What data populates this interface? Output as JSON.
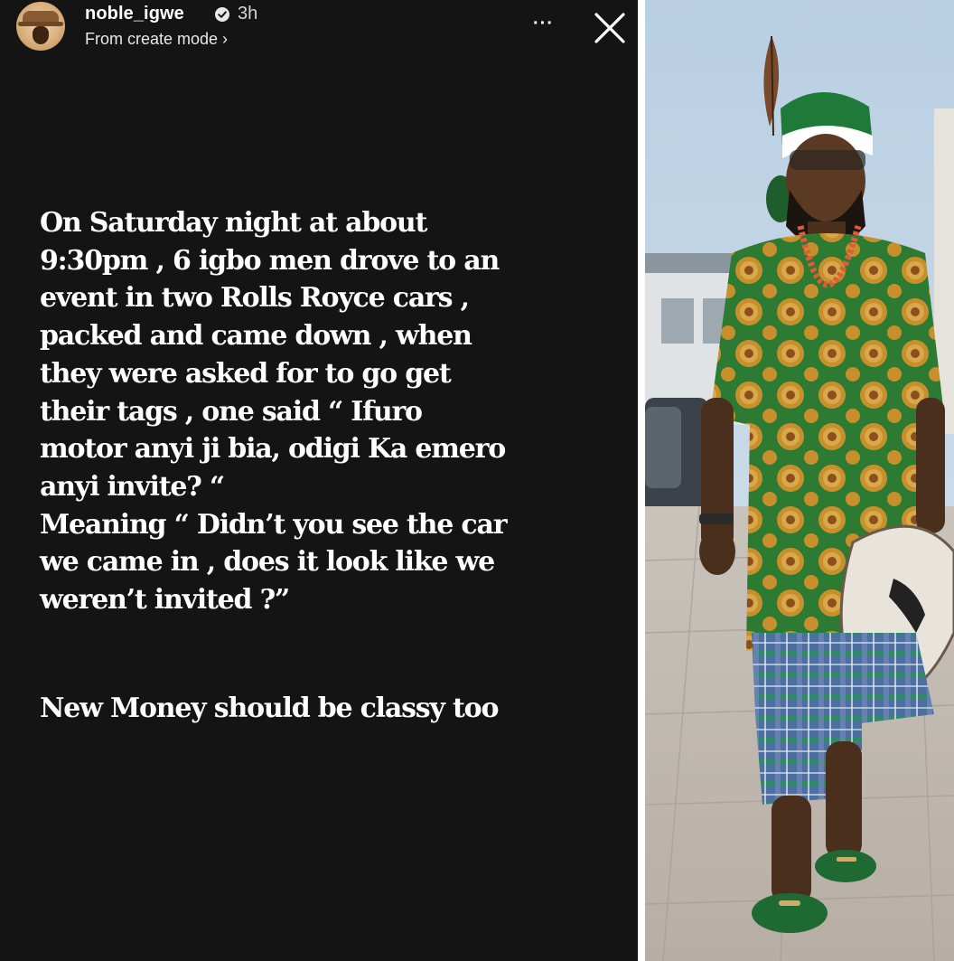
{
  "story": {
    "username": "noble_igwe",
    "time": "3h",
    "subtitle": "From create mode ›",
    "more_label": "···",
    "body": "On Saturday night at about\n9:30pm , 6 igbo men drove to an\nevent in two Rolls Royce cars ,\npacked and came down , when\nthey were asked for to go get\ntheir tags , one said “ Ifuro\nmotor anyi ji bia, odigi Ka emero\nanyi invite? “\nMeaning “ Didn’t you see the car\nwe came in , does it look like we\nweren’t invited ?”",
    "tagline": "New Money should be classy too"
  },
  "icons": {
    "verified": "verified-badge-icon",
    "more": "more-options-icon",
    "close": "close-icon"
  },
  "colors": {
    "story_background": "#141414",
    "text": "#ffffff"
  }
}
